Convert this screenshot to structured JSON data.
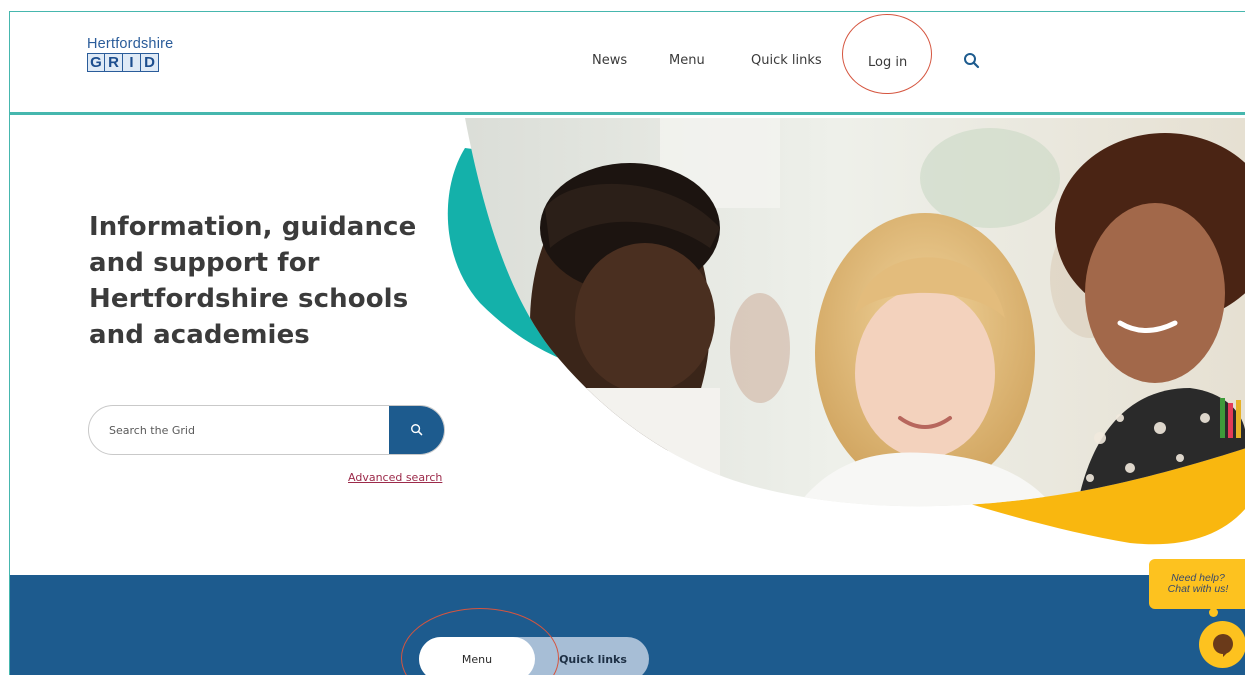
{
  "logo": {
    "word": "Hertfordshire",
    "letters": [
      "G",
      "R",
      "I",
      "D"
    ]
  },
  "nav": {
    "news": "News",
    "menu": "Menu",
    "quick_links": "Quick links",
    "log_in": "Log in",
    "search_icon": "search-icon"
  },
  "hero": {
    "title": "Information, guidance and support for Hertfordshire schools and academies",
    "search_placeholder": "Search the Grid",
    "advanced_search": "Advanced search"
  },
  "band": {
    "menu": "Menu",
    "quick_links": "Quick links"
  },
  "chat": {
    "line1": "Need help?",
    "line2": "Chat with us!"
  },
  "colors": {
    "teal": "#46b7ae",
    "navy": "#1d5b8e",
    "yellow": "#fdc21f",
    "link": "#9c2a4a",
    "annotation": "#d5553f"
  }
}
